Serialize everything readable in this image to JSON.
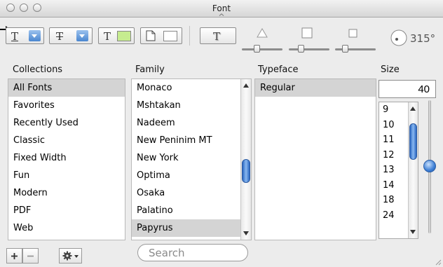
{
  "window": {
    "title": "Font",
    "rotation": "315°"
  },
  "toolbar": {
    "underline_glyph": "T",
    "strike_glyph": "T",
    "textcolor_glyph": "T",
    "textcolor_swatch": "#c6ec8f",
    "shadow_glyph": "T",
    "accent_color": "#4a86d0"
  },
  "columns": {
    "collections": "Collections",
    "family": "Family",
    "typeface": "Typeface",
    "size": "Size"
  },
  "collections": [
    {
      "label": "All Fonts",
      "selected": true
    },
    {
      "label": "Favorites"
    },
    {
      "label": "Recently Used"
    },
    {
      "label": "Classic"
    },
    {
      "label": "Fixed Width"
    },
    {
      "label": "Fun"
    },
    {
      "label": "Modern"
    },
    {
      "label": "PDF"
    },
    {
      "label": "Web"
    }
  ],
  "families": [
    {
      "label": "Monaco"
    },
    {
      "label": "Mshtakan"
    },
    {
      "label": "Nadeem"
    },
    {
      "label": "New Peninim MT"
    },
    {
      "label": "New York"
    },
    {
      "label": "Optima"
    },
    {
      "label": "Osaka"
    },
    {
      "label": "Palatino"
    },
    {
      "label": "Papyrus",
      "selected": true
    }
  ],
  "typefaces": [
    {
      "label": "Regular",
      "selected": true
    }
  ],
  "size": {
    "value": "40",
    "options": [
      "9",
      "10",
      "11",
      "12",
      "13",
      "14",
      "18",
      "24"
    ]
  },
  "search": {
    "placeholder": "Search"
  }
}
